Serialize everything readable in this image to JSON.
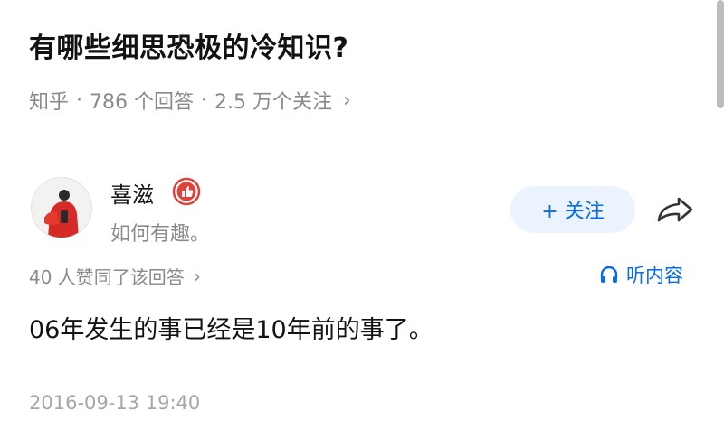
{
  "question": {
    "title": "有哪些细思恐极的冷知识?",
    "source": "知乎",
    "answers_count": "786 个回答",
    "followers": "2.5 万个关注"
  },
  "answer": {
    "author": {
      "name": "喜滋",
      "bio": "如何有趣。",
      "badge_icon": "thumbs-up-badge-icon"
    },
    "follow_label": "+ 关注",
    "vote_text": "40 人赞同了该回答",
    "listen_label": "听内容",
    "content": "06年发生的事已经是10年前的事了。",
    "timestamp": "2016-09-13 19:40"
  },
  "colors": {
    "accent": "#056de8",
    "follow_bg": "#ebf3ff",
    "badge": "#e0413a",
    "meta_text": "#8a8a8a"
  }
}
